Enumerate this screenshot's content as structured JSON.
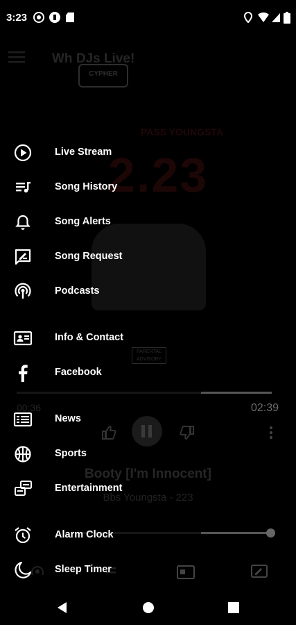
{
  "status": {
    "time": "3:23"
  },
  "background": {
    "title": "Wh            DJs Live!",
    "logo_text": "CYPHER",
    "album_number": "2.23",
    "album_top_text": "PASS YOUNGSTA",
    "parental_badge": "PARENTAL ADVISORY",
    "elapsed": "00:36",
    "duration": "02:39",
    "song_title": "Booty [I'm Innocent]",
    "song_artist": "Bbs Youngsta - 223",
    "progress_fraction": 0.72,
    "volume_fraction": 0.98
  },
  "menu": {
    "items": [
      {
        "label": "Live Stream",
        "icon": "play-circle-icon"
      },
      {
        "label": "Song History",
        "icon": "playlist-icon"
      },
      {
        "label": "Song Alerts",
        "icon": "bell-icon"
      },
      {
        "label": "Song Request",
        "icon": "request-icon"
      },
      {
        "label": "Podcasts",
        "icon": "podcast-icon"
      },
      {
        "label": "Info & Contact",
        "icon": "contact-card-icon"
      },
      {
        "label": "Facebook",
        "icon": "facebook-icon"
      },
      {
        "label": "News",
        "icon": "newspaper-icon"
      },
      {
        "label": "Sports",
        "icon": "basketball-icon"
      },
      {
        "label": "Entertainment",
        "icon": "entertainment-icon"
      },
      {
        "label": "Alarm Clock",
        "icon": "alarm-clock-icon"
      },
      {
        "label": "Sleep Timer",
        "icon": "moon-icon"
      }
    ]
  },
  "colors": {
    "background": "#000000",
    "text": "#ffffff",
    "dim": "#3a3a3a"
  }
}
